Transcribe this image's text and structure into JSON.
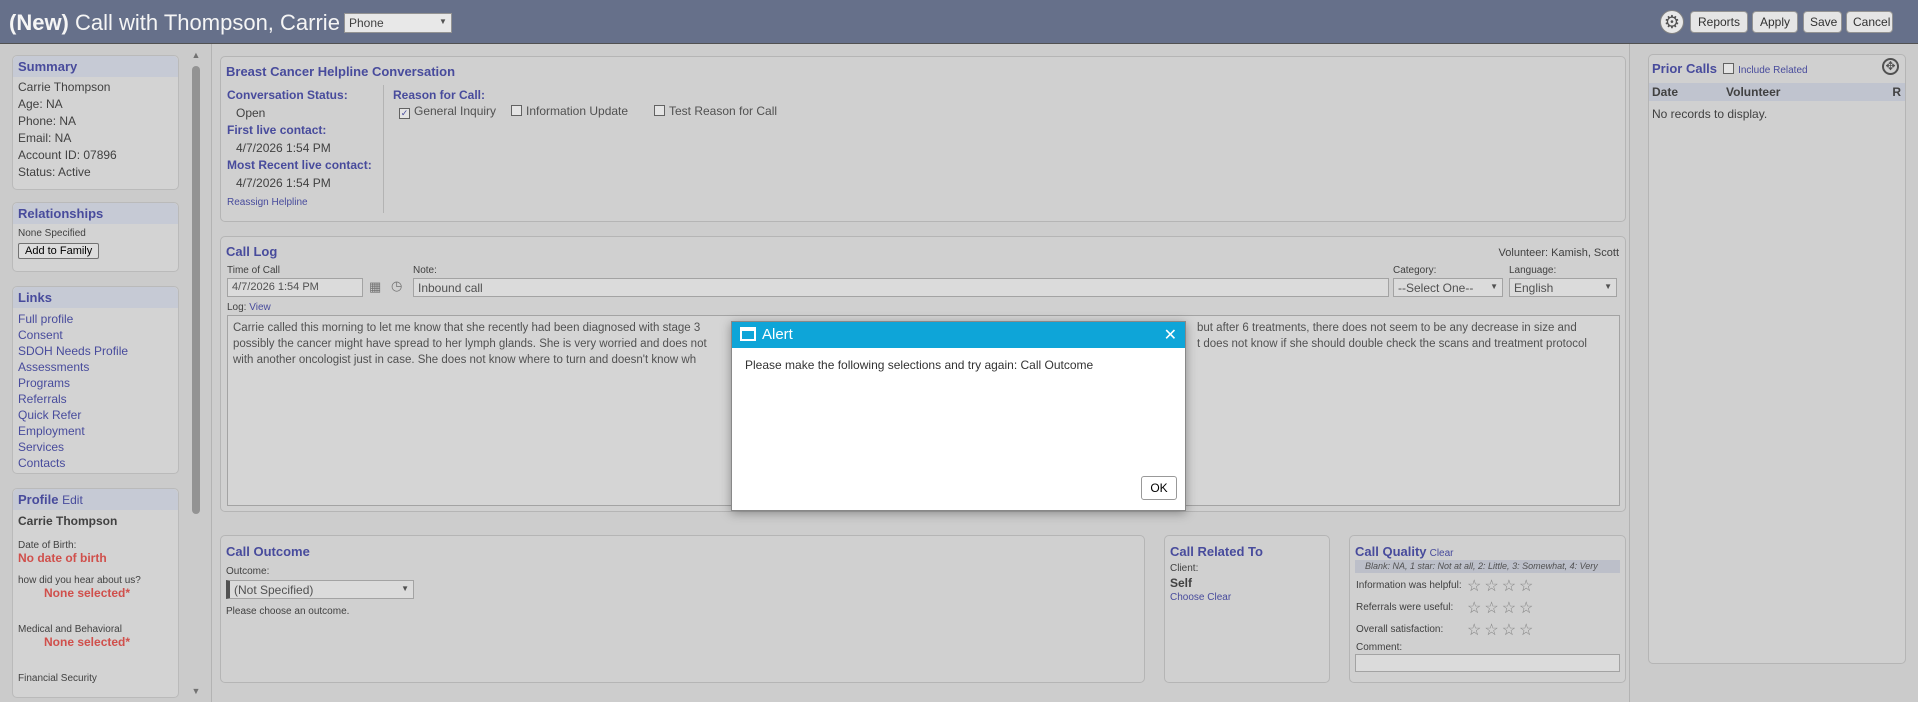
{
  "header": {
    "new_tag": "(New)",
    "title": "Call with Thompson, Carrie",
    "channel": "Phone",
    "reports": "Reports",
    "apply": "Apply",
    "save": "Save",
    "cancel": "Cancel"
  },
  "summary": {
    "title": "Summary",
    "name": "Carrie Thompson",
    "age": "Age: NA",
    "phone": "Phone: NA",
    "email": "Email: NA",
    "account": "Account ID: 07896",
    "status": "Status: Active"
  },
  "relationships": {
    "title": "Relationships",
    "none": "None Specified",
    "add_button": "Add to Family"
  },
  "links": {
    "title": "Links",
    "items": [
      "Full profile",
      "Consent",
      "SDOH Needs Profile",
      "Assessments",
      "Programs",
      "Referrals",
      "Quick Refer",
      "Employment",
      "Services",
      "Contacts"
    ]
  },
  "profile": {
    "title": "Profile",
    "edit": "Edit",
    "name": "Carrie Thompson",
    "dob_label": "Date of Birth:",
    "dob_value": "No date of birth",
    "hear_label": "how did you hear about us?",
    "hear_value": "None selected*",
    "medical_label": "Medical and Behavioral",
    "medical_value": "None selected*",
    "financial_label": "Financial Security"
  },
  "conversation": {
    "title": "Breast Cancer Helpline Conversation",
    "status_label": "Conversation Status:",
    "status_value": "Open",
    "first_label": "First live contact:",
    "first_value": "4/7/2026 1:54 PM",
    "recent_label": "Most Recent live contact:",
    "recent_value": "4/7/2026 1:54 PM",
    "reassign": "Reassign Helpline",
    "reason_label": "Reason for Call:",
    "reasons": [
      {
        "label": "General Inquiry",
        "checked": true
      },
      {
        "label": "Information Update",
        "checked": false
      },
      {
        "label": "Test Reason for Call",
        "checked": false
      }
    ]
  },
  "call_log": {
    "title": "Call Log",
    "volunteer_label": "Volunteer:",
    "volunteer": "Kamish, Scott",
    "time_label": "Time of Call",
    "time_value": "4/7/2026 1:54 PM",
    "note_label": "Note:",
    "note_value": "Inbound call",
    "category_label": "Category:",
    "category_value": "--Select One--",
    "language_label": "Language:",
    "language_value": "English",
    "log_label": "Log:",
    "log_view": "View",
    "log_line1a": "Carrie called this morning to let me know that she recently had been diagnosed with stage 3",
    "log_line1b": "but after 6 treatments, there does not seem to be any decrease in size and",
    "log_line2a": "possibly the cancer might have spread to her lymph glands. She is very worried and does not",
    "log_line2b": "t does not know if she should double check the scans and treatment protocol",
    "log_line3a": "with another oncologist just in case.  She does not know where to turn and doesn't know wh"
  },
  "outcome": {
    "title": "Call Outcome",
    "label": "Outcome:",
    "value": "(Not Specified)",
    "hint": "Please choose an outcome."
  },
  "related": {
    "title": "Call Related To",
    "client_label": "Client:",
    "client_value": "Self",
    "choose": "Choose",
    "clear": "Clear"
  },
  "quality": {
    "title": "Call Quality",
    "clear": "Clear",
    "legend": "Blank: NA, 1 star: Not at all, 2: Little, 3: Somewhat, 4: Very",
    "q1": "Information was helpful:",
    "q2": "Referrals were useful:",
    "q3": "Overall satisfaction:",
    "comment": "Comment:",
    "ratings": [
      0,
      0,
      0
    ]
  },
  "prior_calls": {
    "title": "Prior Calls",
    "include_related": "Include Related",
    "col_date": "Date",
    "col_volunteer": "Volunteer",
    "col_r": "R",
    "empty": "No records to display."
  },
  "alert": {
    "title": "Alert",
    "message": "Please make the following selections and try again: Call Outcome",
    "ok": "OK"
  },
  "icons": {
    "gear": "gear-icon",
    "calendar": "calendar-icon",
    "clock": "clock-icon",
    "expand": "expand-icon",
    "window": "window-icon",
    "close": "close-icon"
  },
  "colors": {
    "header_bg": "#6b7590",
    "link": "#4b4fa3",
    "alert_header": "#0ea5d8",
    "required": "#d9534f"
  }
}
